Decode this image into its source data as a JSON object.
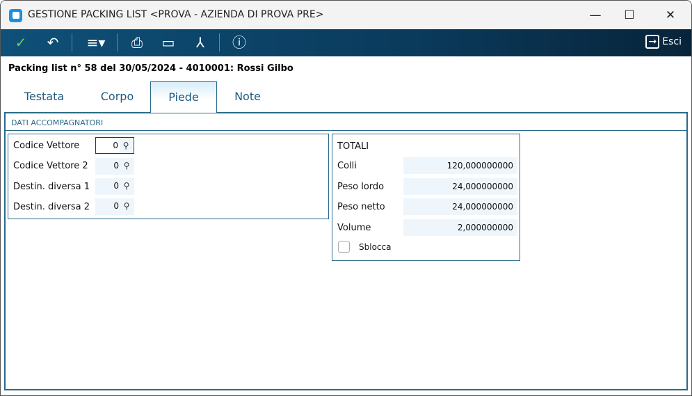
{
  "window": {
    "title": "GESTIONE PACKING LIST <PROVA - AZIENDA DI PROVA PRE>",
    "minimize": "—",
    "maximize": "☐",
    "close": "✕"
  },
  "toolbar": {
    "exit_label": "Esci",
    "icons": [
      "check-icon",
      "undo-icon",
      "menu-icon",
      "print-icon",
      "monitor-icon",
      "pdf-icon",
      "help-icon"
    ]
  },
  "header": "Packing list n° 58 del 30/05/2024 - 4010001: Rossi Gilbo",
  "tabs": [
    {
      "label": "Testata"
    },
    {
      "label": "Corpo"
    },
    {
      "label": "Piede",
      "active": true
    },
    {
      "label": "Note"
    }
  ],
  "section_title": "DATI ACCOMPAGNATORI",
  "fields": [
    {
      "label": "Codice Vettore",
      "value": "0"
    },
    {
      "label": "Codice Vettore 2",
      "value": "0"
    },
    {
      "label": "Destin. diversa 1",
      "value": "0"
    },
    {
      "label": "Destin. diversa 2",
      "value": "0"
    }
  ],
  "totali": {
    "title": "TOTALI",
    "rows": [
      {
        "label": "Colli",
        "value": "120,000000000"
      },
      {
        "label": "Peso lordo",
        "value": "24,000000000"
      },
      {
        "label": "Peso netto",
        "value": "24,000000000"
      },
      {
        "label": "Volume",
        "value": "2,000000000"
      }
    ],
    "unlock_label": "Sblocca",
    "unlock_checked": false
  }
}
